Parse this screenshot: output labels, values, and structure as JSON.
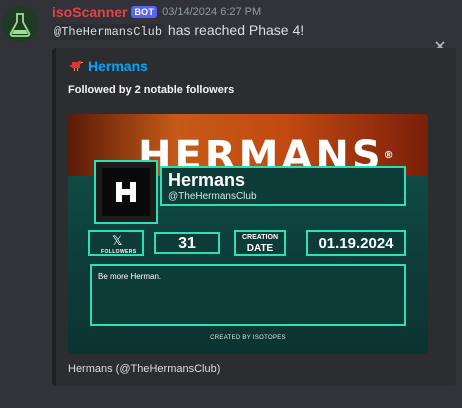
{
  "message": {
    "username": "isoScanner",
    "bot_tag": "BOT",
    "timestamp": "03/14/2024 6:27 PM",
    "mention": "@TheHermansClub",
    "text": "has reached Phase 4!"
  },
  "embed": {
    "author": "Hermans",
    "title": "Followed by 2 notable followers",
    "footer": "Hermans (@TheHermansClub)",
    "card": {
      "banner_word": "HERMANS",
      "banner_mark": "®",
      "logo_letter": "H",
      "name": "Hermans",
      "handle": "@TheHermansClub",
      "x_glyph": "𝕏",
      "followers_label": "FOLLOWERS",
      "followers_count": "31",
      "creation_label_1": "CREATION",
      "creation_label_2": "DATE",
      "creation_date": "01.19.2024",
      "bio": "Be more Herman.",
      "created_by": "CREATED BY ISOTOPES"
    }
  },
  "colors": {
    "username": "#e8414a",
    "bot_badge": "#5865f2",
    "author": "#00a8fc",
    "accent": "#2de0b3"
  },
  "icons": {
    "avatar": "flask-icon",
    "author": "bird-icon",
    "close": "close-icon"
  }
}
